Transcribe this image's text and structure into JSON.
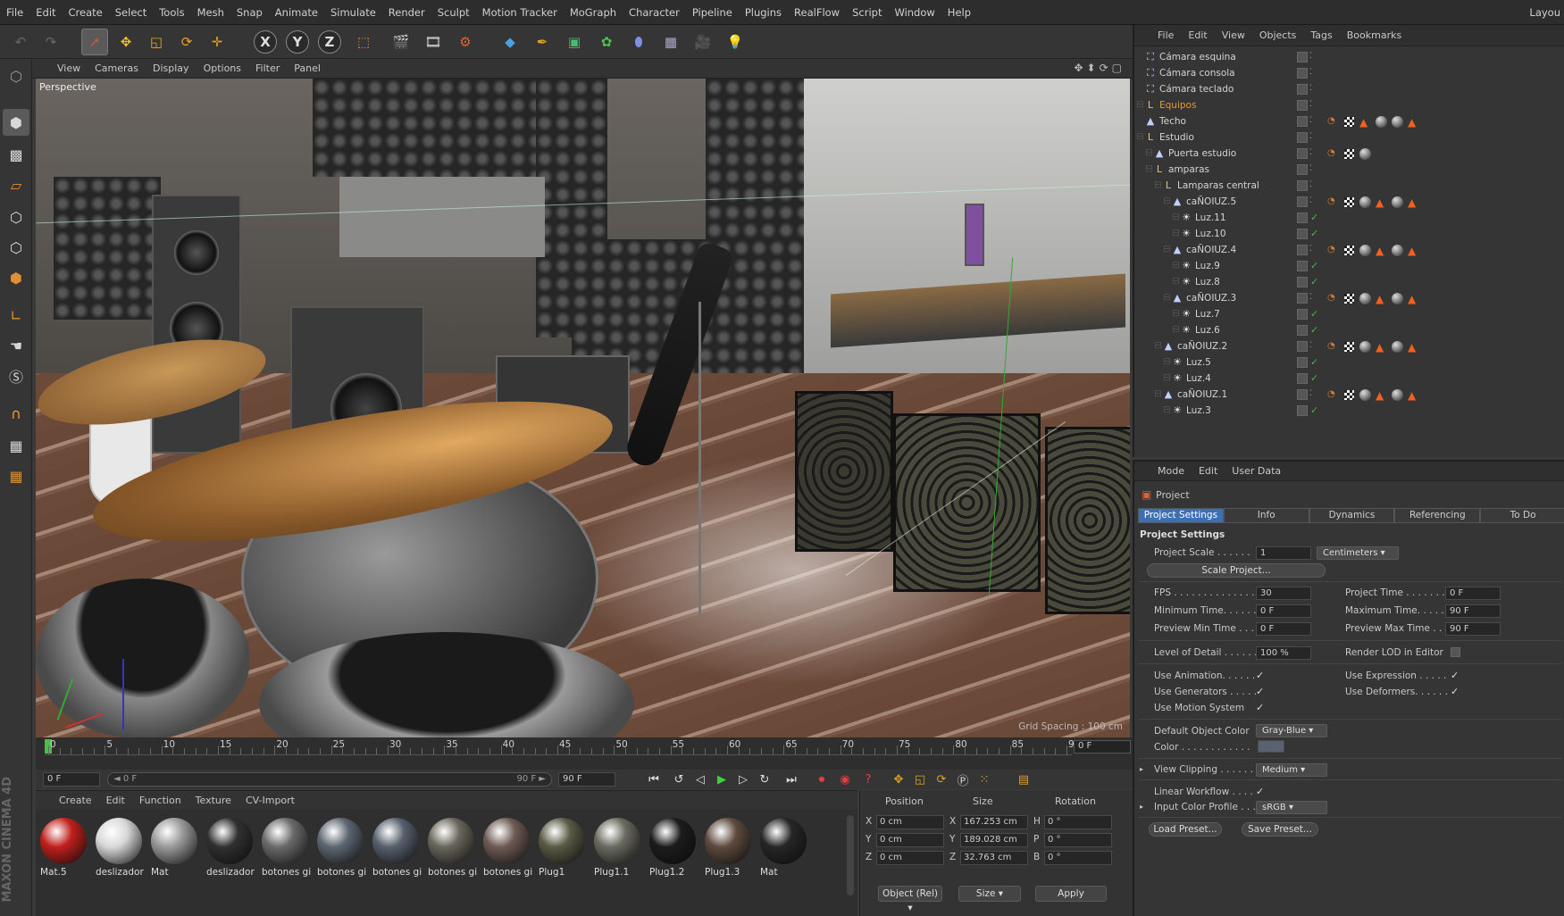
{
  "menubar": {
    "items": [
      "File",
      "Edit",
      "Create",
      "Select",
      "Tools",
      "Mesh",
      "Snap",
      "Animate",
      "Simulate",
      "Render",
      "Sculpt",
      "Motion Tracker",
      "MoGraph",
      "Character",
      "Pipeline",
      "Plugins",
      "RealFlow",
      "Script",
      "Window",
      "Help"
    ],
    "layout": "Layou"
  },
  "toolbar": {
    "x": "X",
    "y": "Y",
    "z": "Z"
  },
  "brand": "MAXON CINEMA 4D",
  "viewport": {
    "menu": [
      "View",
      "Cameras",
      "Display",
      "Options",
      "Filter",
      "Panel"
    ],
    "label": "Perspective",
    "grid": "Grid Spacing : 100 cm"
  },
  "timeline": {
    "ticks": [
      "0",
      "5",
      "10",
      "15",
      "20",
      "25",
      "30",
      "35",
      "40",
      "45",
      "50",
      "55",
      "60",
      "65",
      "70",
      "75",
      "80",
      "85",
      "90"
    ],
    "frame": "0 F",
    "start": "0 F",
    "slider_left": "◄ 0 F",
    "slider_right": "90 F ►",
    "end": "90 F"
  },
  "materials": {
    "menu": [
      "Create",
      "Edit",
      "Function",
      "Texture",
      "CV-Import"
    ],
    "items": [
      {
        "name": "Mat.5",
        "color": "#c0201c",
        "icon": "red-black-sphere"
      },
      {
        "name": "deslizador",
        "color": "#d8d8d8",
        "icon": "white-sphere"
      },
      {
        "name": "Mat",
        "color": "#9a9a9a",
        "icon": "mesh-sphere"
      },
      {
        "name": "deslizador",
        "color": "#303030",
        "icon": "black-sphere"
      },
      {
        "name": "botones gi",
        "color": "#6a6a6a",
        "icon": "gray-sphere"
      },
      {
        "name": "botones gi",
        "color": "#5c6670",
        "icon": "blue-gray-sphere"
      },
      {
        "name": "botones gi",
        "color": "#56606c",
        "icon": "blue-gray-sphere"
      },
      {
        "name": "botones gi",
        "color": "#6a665c",
        "icon": "olive-sphere"
      },
      {
        "name": "botones gi",
        "color": "#6e5a54",
        "icon": "brown-sphere"
      },
      {
        "name": "Plug1",
        "color": "#5a5a46",
        "icon": "dark-olive-sphere"
      },
      {
        "name": "Plug1.1",
        "color": "#6a6a60",
        "icon": "gray-sphere"
      },
      {
        "name": "Plug1.2",
        "color": "#1c1c1c",
        "icon": "black-sphere"
      },
      {
        "name": "Plug1.3",
        "color": "#5e4a3e",
        "icon": "brown-sphere"
      },
      {
        "name": "Mat",
        "color": "#262626",
        "icon": "black-sphere"
      }
    ]
  },
  "coords": {
    "headers": [
      "Position",
      "Size",
      "Rotation"
    ],
    "rows": [
      {
        "axis": "X",
        "pos": "0 cm",
        "size_axis": "X",
        "size": "167.253 cm",
        "rot_axis": "H",
        "rot": "0 °"
      },
      {
        "axis": "Y",
        "pos": "0 cm",
        "size_axis": "Y",
        "size": "189.028 cm",
        "rot_axis": "P",
        "rot": "0 °"
      },
      {
        "axis": "Z",
        "pos": "0 cm",
        "size_axis": "Z",
        "size": "32.763 cm",
        "rot_axis": "B",
        "rot": "0 °"
      }
    ],
    "mode": "Object (Rel)",
    "size_mode": "Size",
    "apply": "Apply"
  },
  "objects": {
    "menu": [
      "File",
      "Edit",
      "View",
      "Objects",
      "Tags",
      "Bookmarks"
    ],
    "rows": [
      {
        "name": "Cámara esquina",
        "indent": 0,
        "icon": "camera-icon",
        "tags": [],
        "check": false
      },
      {
        "name": "Cámara consola",
        "indent": 0,
        "icon": "camera-icon",
        "tags": [],
        "check": false
      },
      {
        "name": "Cámara teclado",
        "indent": 0,
        "icon": "camera-icon",
        "tags": [],
        "check": false
      },
      {
        "name": "Equipos",
        "indent": 0,
        "icon": "null-icon",
        "tags": [],
        "check": false,
        "color": "#e09a3a"
      },
      {
        "name": "Techo",
        "indent": 0,
        "icon": "polygon-icon",
        "tags": [
          "phong",
          "checker",
          "triangle",
          "sphere",
          "sphere",
          "triangle"
        ],
        "check": false
      },
      {
        "name": "Estudio",
        "indent": 0,
        "icon": "null-icon",
        "tags": [],
        "check": false
      },
      {
        "name": "Puerta estudio",
        "indent": 1,
        "icon": "polygon-icon",
        "tags": [
          "phong",
          "checker",
          "sphere"
        ],
        "check": false
      },
      {
        "name": "amparas",
        "indent": 1,
        "icon": "null-icon",
        "tags": [],
        "check": false
      },
      {
        "name": "Lamparas central",
        "indent": 2,
        "icon": "null-icon",
        "tags": [],
        "check": false
      },
      {
        "name": "caÑOIUZ.5",
        "indent": 3,
        "icon": "polygon-icon",
        "tags": [
          "phong",
          "checker",
          "sphere",
          "triangle",
          "sphere",
          "triangle"
        ],
        "check": false
      },
      {
        "name": "Luz.11",
        "indent": 4,
        "icon": "light-icon",
        "tags": [],
        "check": true
      },
      {
        "name": "Luz.10",
        "indent": 4,
        "icon": "light-icon",
        "tags": [],
        "check": true
      },
      {
        "name": "caÑOIUZ.4",
        "indent": 3,
        "icon": "polygon-icon",
        "tags": [
          "phong",
          "checker",
          "sphere",
          "triangle",
          "sphere",
          "triangle"
        ],
        "check": false
      },
      {
        "name": "Luz.9",
        "indent": 4,
        "icon": "light-icon",
        "tags": [],
        "check": true
      },
      {
        "name": "Luz.8",
        "indent": 4,
        "icon": "light-icon",
        "tags": [],
        "check": true
      },
      {
        "name": "caÑOIUZ.3",
        "indent": 3,
        "icon": "polygon-icon",
        "tags": [
          "phong",
          "checker",
          "sphere",
          "triangle",
          "sphere",
          "triangle"
        ],
        "check": false
      },
      {
        "name": "Luz.7",
        "indent": 4,
        "icon": "light-icon",
        "tags": [],
        "check": true
      },
      {
        "name": "Luz.6",
        "indent": 4,
        "icon": "light-icon",
        "tags": [],
        "check": true
      },
      {
        "name": "caÑOIUZ.2",
        "indent": 2,
        "icon": "polygon-icon",
        "tags": [
          "phong",
          "checker",
          "sphere",
          "triangle",
          "sphere",
          "triangle"
        ],
        "check": false
      },
      {
        "name": "Luz.5",
        "indent": 3,
        "icon": "light-icon",
        "tags": [],
        "check": true
      },
      {
        "name": "Luz.4",
        "indent": 3,
        "icon": "light-icon",
        "tags": [],
        "check": true
      },
      {
        "name": "caÑOIUZ.1",
        "indent": 2,
        "icon": "polygon-icon",
        "tags": [
          "phong",
          "checker",
          "sphere",
          "triangle",
          "sphere",
          "triangle"
        ],
        "check": false
      },
      {
        "name": "Luz.3",
        "indent": 3,
        "icon": "light-icon",
        "tags": [],
        "check": true
      }
    ]
  },
  "attributes": {
    "menu": [
      "Mode",
      "Edit",
      "User Data"
    ],
    "title": "Project",
    "tabs": [
      "Project Settings",
      "Info",
      "Dynamics",
      "Referencing",
      "To Do"
    ],
    "section": "Project Settings",
    "project_scale_label": "Project Scale . . . . . .",
    "project_scale": "1",
    "project_scale_unit": "Centimeters",
    "scale_project": "Scale Project...",
    "fps_label": "FPS . . . . . . . . . . . . . . .",
    "fps": "30",
    "project_time_label": "Project Time . . . . . . . .",
    "project_time": "0 F",
    "min_time_label": "Minimum Time. . . . . .",
    "min_time": "0 F",
    "max_time_label": "Maximum Time. . . . . .",
    "max_time": "90 F",
    "prev_min_label": "Preview Min Time . . .",
    "prev_min": "0 F",
    "prev_max_label": "Preview Max Time . . .",
    "prev_max": "90 F",
    "lod_label": "Level of Detail . . . . . .",
    "lod": "100 %",
    "render_lod_label": "Render LOD in Editor",
    "use_animation": "Use Animation. . . . . .",
    "use_expression": "Use Expression . . . . .",
    "use_generators": "Use Generators . . . . .",
    "use_deformers": "Use Deformers. . . . . .",
    "use_motion": "Use Motion System",
    "default_color_label": "Default Object Color",
    "default_color": "Gray-Blue",
    "color_label": "Color . . . . . . . . . . . .",
    "view_clipping_label": "View Clipping . . . . . .",
    "view_clipping": "Medium",
    "linear_workflow_label": "Linear Workflow . . . .",
    "input_profile_label": "Input Color Profile . . .",
    "input_profile": "sRGB",
    "load_preset": "Load Preset...",
    "save_preset": "Save Preset..."
  },
  "colors": {
    "accent": "#3d6fb3",
    "panel": "#353535",
    "check": "#4caf50",
    "orange": "#e07020"
  }
}
